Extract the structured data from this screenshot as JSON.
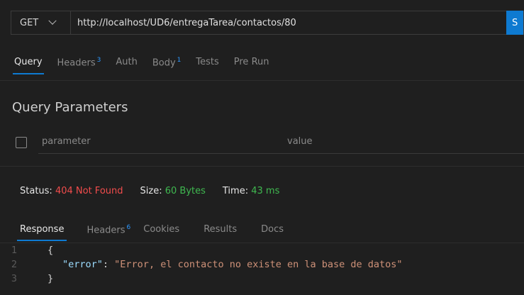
{
  "request": {
    "method": "GET",
    "url": "http://localhost/UD6/entregaTarea/contactos/80",
    "send_label": "S"
  },
  "request_tabs": [
    {
      "label": "Query",
      "badge": ""
    },
    {
      "label": "Headers",
      "badge": "3"
    },
    {
      "label": "Auth",
      "badge": ""
    },
    {
      "label": "Body",
      "badge": "1"
    },
    {
      "label": "Tests",
      "badge": ""
    },
    {
      "label": "Pre Run",
      "badge": ""
    }
  ],
  "query": {
    "title": "Query Parameters",
    "param_placeholder": "parameter",
    "value_placeholder": "value"
  },
  "status": {
    "status_label": "Status:",
    "status_value": "404 Not Found",
    "size_label": "Size:",
    "size_value": "60 Bytes",
    "time_label": "Time:",
    "time_value": "43 ms"
  },
  "response_tabs": [
    {
      "label": "Response",
      "badge": ""
    },
    {
      "label": "Headers",
      "badge": "6"
    },
    {
      "label": "Cookies",
      "badge": ""
    },
    {
      "label": "Results",
      "badge": ""
    },
    {
      "label": "Docs",
      "badge": ""
    }
  ],
  "response_body": {
    "line1_num": "1",
    "line1": "{",
    "line2_num": "2",
    "line2_key": "\"error\"",
    "line2_sep": ": ",
    "line2_value": "\"Error, el contacto no existe en la base de datos\"",
    "line3_num": "3",
    "line3": "}"
  },
  "colors": {
    "accent": "#0e7ad1",
    "error": "#f14c4c",
    "success": "#3fb950"
  }
}
